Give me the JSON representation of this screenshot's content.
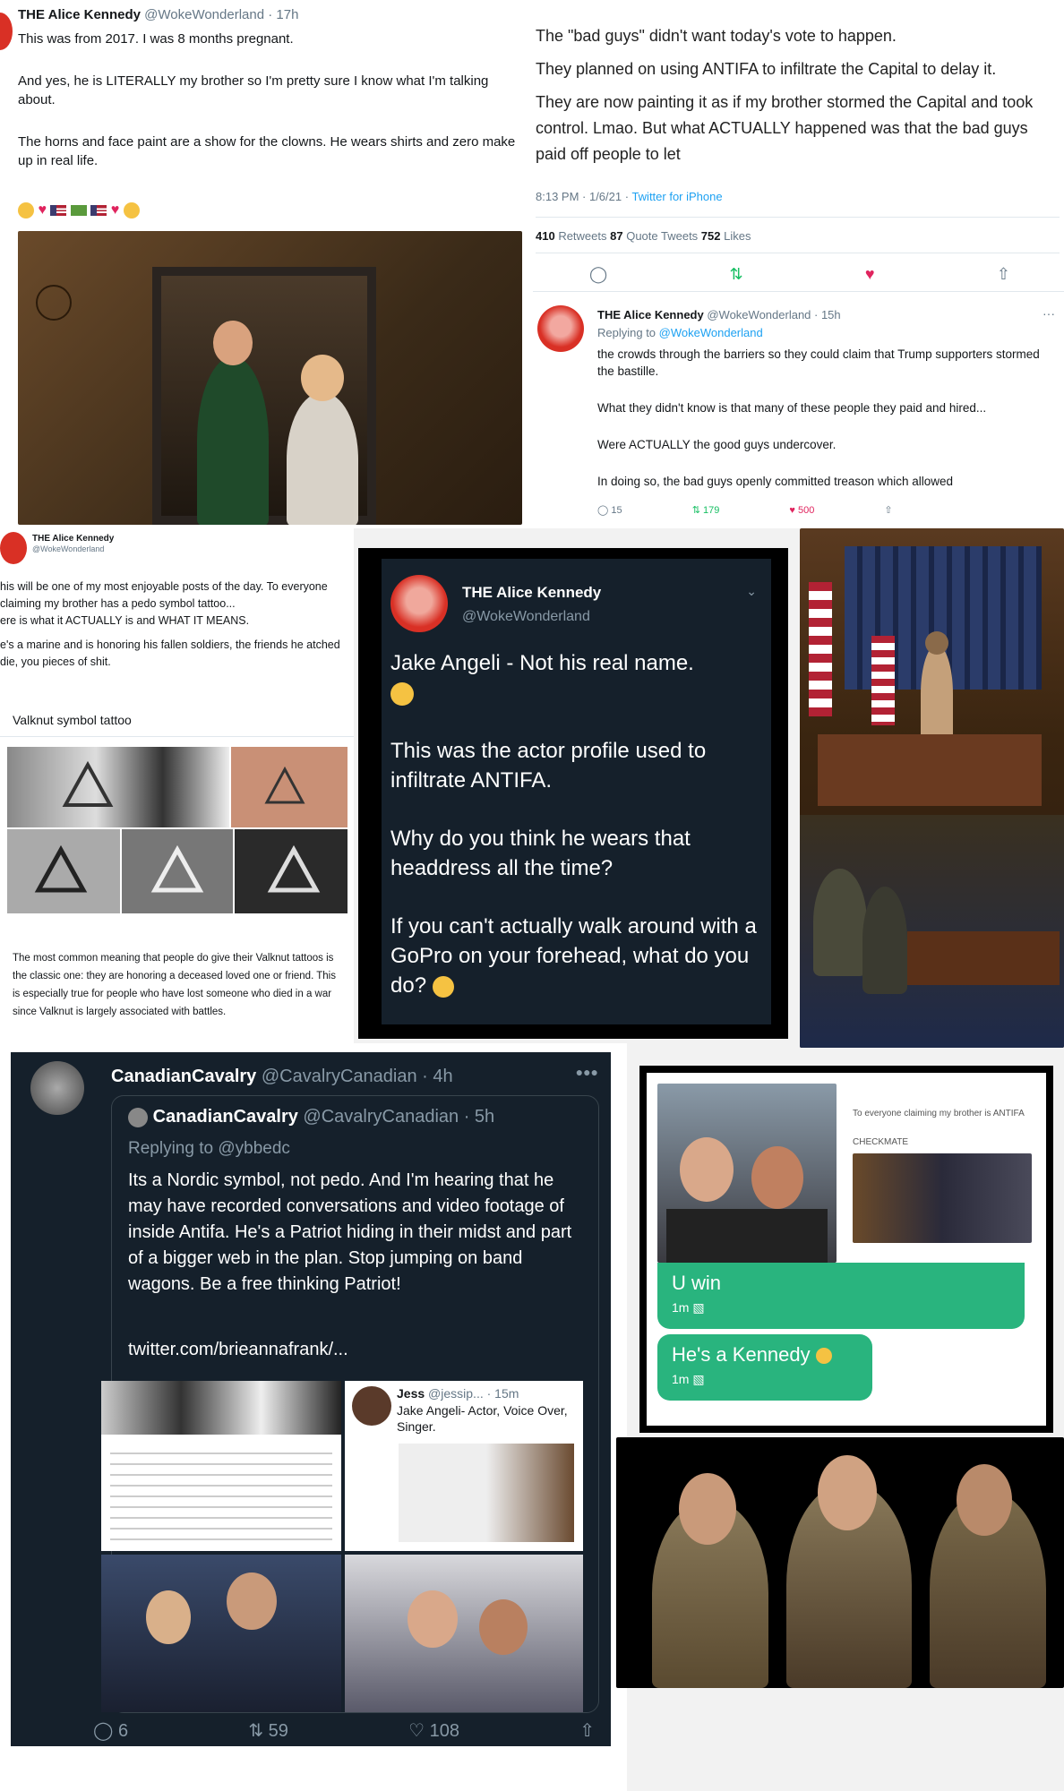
{
  "tweet1": {
    "author": "THE Alice Kennedy",
    "handle": "@WokeWonderland",
    "time": "· 17h",
    "p1": "This was from 2017. I was 8 months pregnant.",
    "p2": "And yes, he is LITERALLY my brother so I'm pretty sure I know what I'm talking about.",
    "p3": "The horns and face paint are a show for the clowns. He wears shirts and zero make up in real life."
  },
  "tweet2": {
    "line1": "The \"bad guys\" didn't want today's vote to happen.",
    "line2": "They planned on using ANTIFA to infiltrate the Capital to delay it.",
    "line3": "They are now painting it as if my brother stormed the Capital and took control. Lmao. But what ACTUALLY happened was that the bad guys paid off people to let",
    "time": "8:13 PM · 1/6/21 · ",
    "source": "Twitter for iPhone",
    "retweets": "410",
    "retweets_label": " Retweets  ",
    "quotes": "87",
    "quotes_label": " Quote Tweets  ",
    "likes": "752",
    "likes_label": " Likes"
  },
  "reply": {
    "author": "THE Alice Kennedy",
    "handle": "@WokeWonderland · 15h",
    "replying": "Replying to ",
    "replying_to": "@WokeWonderland",
    "p1": "the crowds through the barriers so they could claim that Trump supporters stormed the bastille.",
    "p2": "What they didn't know is that many of these people they paid and hired...",
    "p3": "Were ACTUALLY the good guys undercover.",
    "p4": "In doing so, the bad guys openly committed treason which allowed",
    "c_reply": "15",
    "c_rt": "179",
    "c_like": "500"
  },
  "valknut": {
    "author": "THE Alice Kennedy",
    "handle": "@WokeWonderland",
    "p1": "his will be one of my most enjoyable posts of the day. To everyone claiming my brother has a pedo symbol tattoo...",
    "p2": "ere is what it ACTUALLY is and WHAT IT MEANS.",
    "p3": "e's a marine and is honoring his fallen soldiers, the friends he atched die, you pieces of shit.",
    "label": "Valknut symbol tattoo",
    "caption": "The most common meaning that people do give their Valknut tattoos is the classic one: they are honoring a deceased loved one or friend. This is especially true for people who have lost someone who died in a war since Valknut is largely associated with battles."
  },
  "dark_tweet": {
    "author": "THE Alice Kennedy",
    "handle": "@WokeWonderland",
    "p1": "Jake Angeli - Not his real name.",
    "p2": "This was the actor profile used to infiltrate ANTIFA.",
    "p3": "Why do you think he wears that headdress all the time?",
    "p4": "If you can't actually walk around with a GoPro on your forehead, what do you do?"
  },
  "cavalry": {
    "author": "CanadianCavalry",
    "handle": "@CavalryCanadian · 4h",
    "q_author": "CanadianCavalry",
    "q_handle": "@CavalryCanadian · 5h",
    "replying": "Replying to @ybbedc",
    "body": "Its a Nordic symbol, not pedo. And I'm hearing that he may have recorded conversations and video footage of inside Antifa. He's a Patriot hiding in their midst and part of a bigger web in the plan. Stop jumping on band wagons. Be a free thinking Patriot!",
    "link": "twitter.com/brieannafrank/...",
    "jess_name": "Jess",
    "jess_handle": "@jessip... · 15m",
    "jess_text": "Jake Angeli- Actor, Voice Over, Singer.",
    "replies": "6",
    "retweets": "59",
    "likes": "108"
  },
  "chat": {
    "caption": "To everyone claiming my brother is ANTIFA",
    "caption2": "CHECKMATE",
    "msg1": "U win",
    "msg1_time": "1m",
    "msg2": "He's a Kennedy",
    "msg2_time": "1m"
  }
}
